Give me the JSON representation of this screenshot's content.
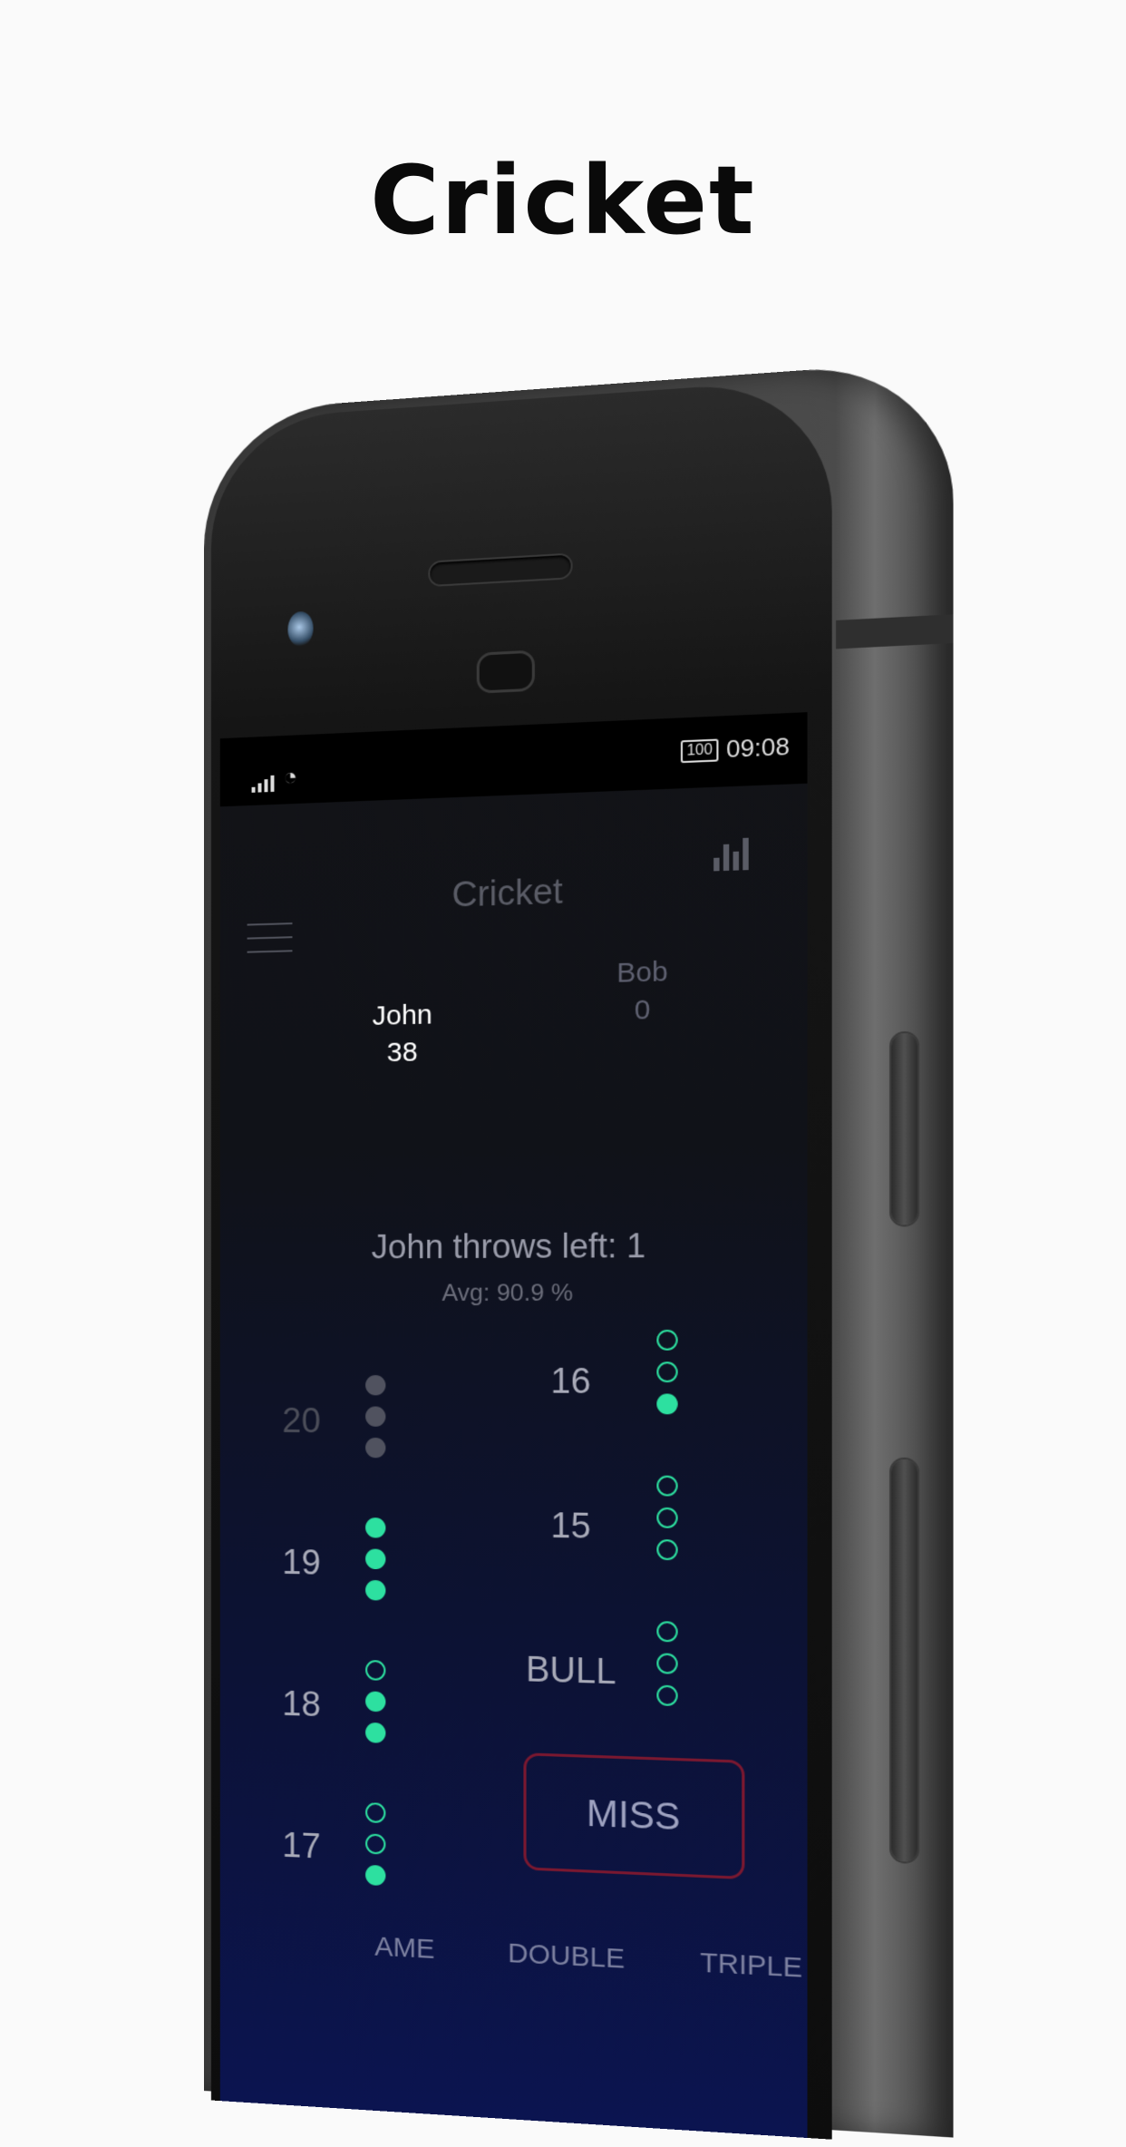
{
  "page_title": "Cricket",
  "status_bar": {
    "battery": "100",
    "time": "09:08"
  },
  "app": {
    "title": "Cricket",
    "players": [
      {
        "name": "John",
        "score": "38"
      },
      {
        "name": "Bob",
        "score": "0"
      }
    ],
    "turn_text": "John throws left: 1",
    "avg_text": "Avg: 90.9 %",
    "left_targets": [
      {
        "label": "20",
        "marks": [
          "grey",
          "grey",
          "grey"
        ]
      },
      {
        "label": "19",
        "marks": [
          "filled",
          "filled",
          "filled"
        ]
      },
      {
        "label": "18",
        "marks": [
          "open",
          "filled",
          "filled"
        ]
      },
      {
        "label": "17",
        "marks": [
          "open",
          "open",
          "filled"
        ]
      }
    ],
    "right_targets": [
      {
        "label": "16",
        "marks": [
          "open",
          "open",
          "filled"
        ]
      },
      {
        "label": "15",
        "marks": [
          "open",
          "open",
          "open"
        ]
      },
      {
        "label": "BULL",
        "marks": [
          "open",
          "open",
          "open"
        ]
      }
    ],
    "miss_label": "MISS",
    "footer_labels": [
      "AME",
      "DOUBLE",
      "TRIPLE"
    ],
    "colors": {
      "accent": "#2de0a0",
      "miss_border": "#7a1830",
      "screen_top": "#121317",
      "screen_bottom": "#0b1450"
    }
  }
}
